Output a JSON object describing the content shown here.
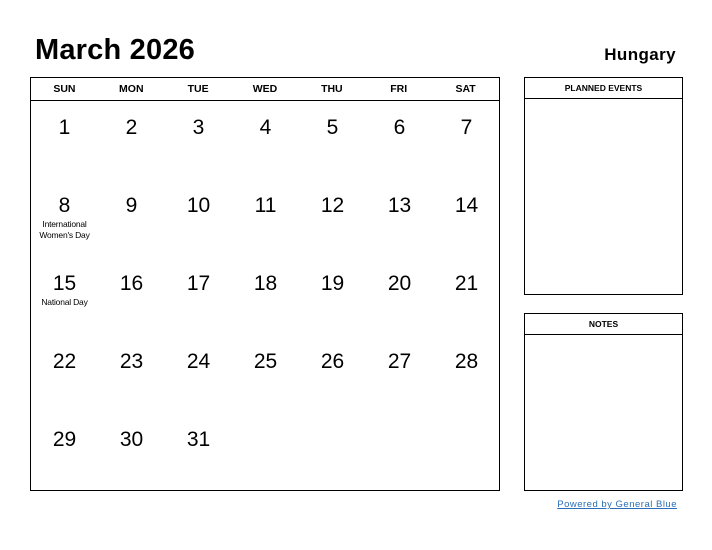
{
  "header": {
    "title": "March 2026",
    "country": "Hungary"
  },
  "calendar": {
    "weekdays": [
      "SUN",
      "MON",
      "TUE",
      "WED",
      "THU",
      "FRI",
      "SAT"
    ],
    "weeks": [
      [
        {
          "day": "1"
        },
        {
          "day": "2"
        },
        {
          "day": "3"
        },
        {
          "day": "4"
        },
        {
          "day": "5"
        },
        {
          "day": "6"
        },
        {
          "day": "7"
        }
      ],
      [
        {
          "day": "8",
          "holiday": "International Women's Day"
        },
        {
          "day": "9"
        },
        {
          "day": "10"
        },
        {
          "day": "11"
        },
        {
          "day": "12"
        },
        {
          "day": "13"
        },
        {
          "day": "14"
        }
      ],
      [
        {
          "day": "15",
          "holiday": "National Day"
        },
        {
          "day": "16"
        },
        {
          "day": "17"
        },
        {
          "day": "18"
        },
        {
          "day": "19"
        },
        {
          "day": "20"
        },
        {
          "day": "21"
        }
      ],
      [
        {
          "day": "22"
        },
        {
          "day": "23"
        },
        {
          "day": "24"
        },
        {
          "day": "25"
        },
        {
          "day": "26"
        },
        {
          "day": "27"
        },
        {
          "day": "28"
        }
      ],
      [
        {
          "day": "29"
        },
        {
          "day": "30"
        },
        {
          "day": "31"
        },
        {
          "day": ""
        },
        {
          "day": ""
        },
        {
          "day": ""
        },
        {
          "day": ""
        }
      ]
    ]
  },
  "side": {
    "planned_label": "PLANNED EVENTS",
    "notes_label": "NOTES"
  },
  "footer": {
    "powered_by": "Powered by General Blue",
    "link_color": "#2a70b8"
  }
}
